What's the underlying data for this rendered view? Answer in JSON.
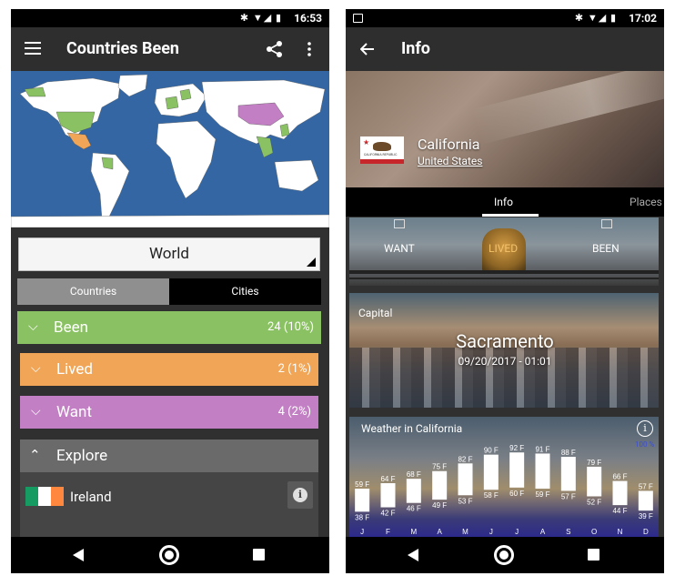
{
  "left": {
    "status": {
      "time": "16:53"
    },
    "appbar": {
      "title": "Countries Been"
    },
    "selector": {
      "value": "World"
    },
    "segments": {
      "countries": "Countries",
      "cities": "Cities"
    },
    "categories": [
      {
        "label": "Been",
        "count": "24 (10%)",
        "color": "#8ac163"
      },
      {
        "label": "Lived",
        "count": "2 (1%)",
        "color": "#f0a557"
      },
      {
        "label": "Want",
        "count": "4 (2%)",
        "color": "#c27fc4"
      }
    ],
    "explore": {
      "label": "Explore",
      "item": "Ireland"
    }
  },
  "right": {
    "status": {
      "time": "17:02"
    },
    "appbar": {
      "title": "Info"
    },
    "hero": {
      "title": "California",
      "subtitle": "United States",
      "flag_text": "CALIFORNIA REPUBLIC"
    },
    "tabs": {
      "info": "Info",
      "places": "Places"
    },
    "status_options": {
      "want": "WANT",
      "lived": "LIVED",
      "been": "BEEN"
    },
    "capital": {
      "label": "Capital",
      "name": "Sacramento",
      "time": "09/20/2017 - 01:01"
    },
    "weather": {
      "title": "Weather in California",
      "percent": "100 %",
      "months": [
        {
          "m": "J",
          "hi": "59 F",
          "lo": "38 F",
          "hv": 59,
          "lv": 38
        },
        {
          "m": "F",
          "hi": "64 F",
          "lo": "42 F",
          "hv": 64,
          "lv": 42
        },
        {
          "m": "M",
          "hi": "68 F",
          "lo": "46 F",
          "hv": 68,
          "lv": 46
        },
        {
          "m": "A",
          "hi": "75 F",
          "lo": "49 F",
          "hv": 75,
          "lv": 49
        },
        {
          "m": "M",
          "hi": "82 F",
          "lo": "53 F",
          "hv": 82,
          "lv": 53
        },
        {
          "m": "J",
          "hi": "90 F",
          "lo": "58 F",
          "hv": 90,
          "lv": 58
        },
        {
          "m": "J",
          "hi": "92 F",
          "lo": "60 F",
          "hv": 92,
          "lv": 60
        },
        {
          "m": "A",
          "hi": "91 F",
          "lo": "59 F",
          "hv": 91,
          "lv": 59
        },
        {
          "m": "S",
          "hi": "88 F",
          "lo": "57 F",
          "hv": 88,
          "lv": 57
        },
        {
          "m": "O",
          "hi": "79 F",
          "lo": "52 F",
          "hv": 79,
          "lv": 52
        },
        {
          "m": "N",
          "hi": "66 F",
          "lo": "44 F",
          "hv": 66,
          "lv": 44
        },
        {
          "m": "D",
          "hi": "57 F",
          "lo": "39 F",
          "hv": 57,
          "lv": 39
        }
      ]
    }
  },
  "colors": {
    "been": "#8ac163",
    "lived": "#f0a557",
    "want": "#c27fc4",
    "ocean": "#3366a3",
    "land": "#ffffff"
  },
  "icons": [
    "menu-icon",
    "share-icon",
    "more-vert-icon",
    "back-arrow-icon",
    "chevron-down-icon",
    "chevron-up-icon",
    "info-icon",
    "bluetooth-icon",
    "wifi-icon",
    "signal-icon",
    "battery-icon",
    "nav-back-icon",
    "nav-home-icon",
    "nav-recent-icon",
    "image-icon"
  ]
}
